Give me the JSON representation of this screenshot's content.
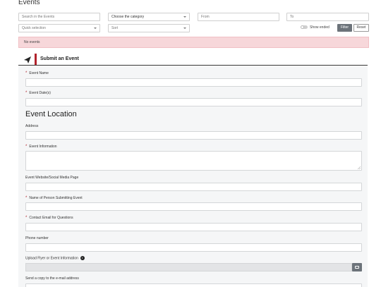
{
  "page": {
    "title": "Events"
  },
  "filters": {
    "search_placeholder": "Search in the Events",
    "category_label": "Choose the category",
    "from_placeholder": "From",
    "to_placeholder": "To",
    "quick_selection_label": "Quick selection",
    "sort_label": "Sort",
    "show_ended_label": "Show ended",
    "filter_button": "Filter",
    "reset_button": "Reset"
  },
  "alert": {
    "text": "No events"
  },
  "submit": {
    "title": "Submit an Event",
    "section_location": "Event Location",
    "fields": {
      "event_name": "Event Name",
      "event_dates": "Event Date(s)",
      "address": "Address",
      "event_information": "Event Information",
      "website": "Event Website/Social Media Page",
      "submitter_name": "Name of Person Submitting Event",
      "contact_email": "Contact Email for Questions",
      "phone": "Phone number",
      "upload_flyer": "Upload Flyer or Event Information",
      "send_copy": "Send a copy to the e-mail address"
    },
    "required_marker": "*"
  },
  "colors": {
    "accent": "#b1232c",
    "alert_bg": "#f7d7da",
    "button_dark": "#6c737a",
    "panel_bg": "#f5f6f7"
  }
}
